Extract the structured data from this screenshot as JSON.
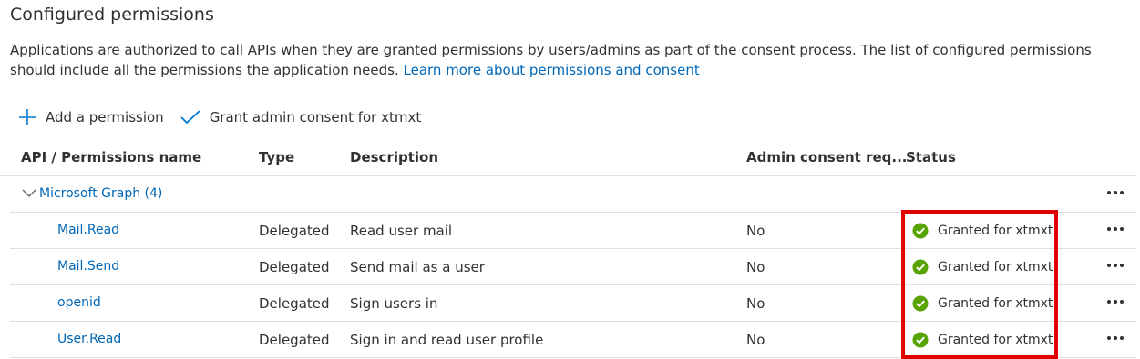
{
  "header": {
    "title": "Configured permissions",
    "description": "Applications are authorized to call APIs when they are granted permissions by users/admins as part of the consent process. The list of configured permissions should include all the permissions the application needs.",
    "learn_more": "Learn more about permissions and consent"
  },
  "toolbar": {
    "add_label": "Add a permission",
    "grant_label": "Grant admin consent for xtmxt"
  },
  "table": {
    "columns": [
      "API / Permissions name",
      "Type",
      "Description",
      "Admin consent req...",
      "Status"
    ],
    "group": {
      "label": "Microsoft Graph (4)"
    },
    "rows": [
      {
        "name": "Mail.Read",
        "type": "Delegated",
        "description": "Read user mail",
        "admin_consent": "No",
        "status": "Granted for xtmxt"
      },
      {
        "name": "Mail.Send",
        "type": "Delegated",
        "description": "Send mail as a user",
        "admin_consent": "No",
        "status": "Granted for xtmxt"
      },
      {
        "name": "openid",
        "type": "Delegated",
        "description": "Sign users in",
        "admin_consent": "No",
        "status": "Granted for xtmxt"
      },
      {
        "name": "User.Read",
        "type": "Delegated",
        "description": "Sign in and read user profile",
        "admin_consent": "No",
        "status": "Granted for xtmxt"
      }
    ]
  },
  "colors": {
    "link": "#0067b8",
    "success": "#57a300",
    "highlight": "#e00000"
  },
  "icons": {
    "add": "plus-icon",
    "grant": "checkmark-icon",
    "expand": "chevron-down-icon",
    "status": "check-circle-icon",
    "more": "more-horizontal-icon"
  }
}
